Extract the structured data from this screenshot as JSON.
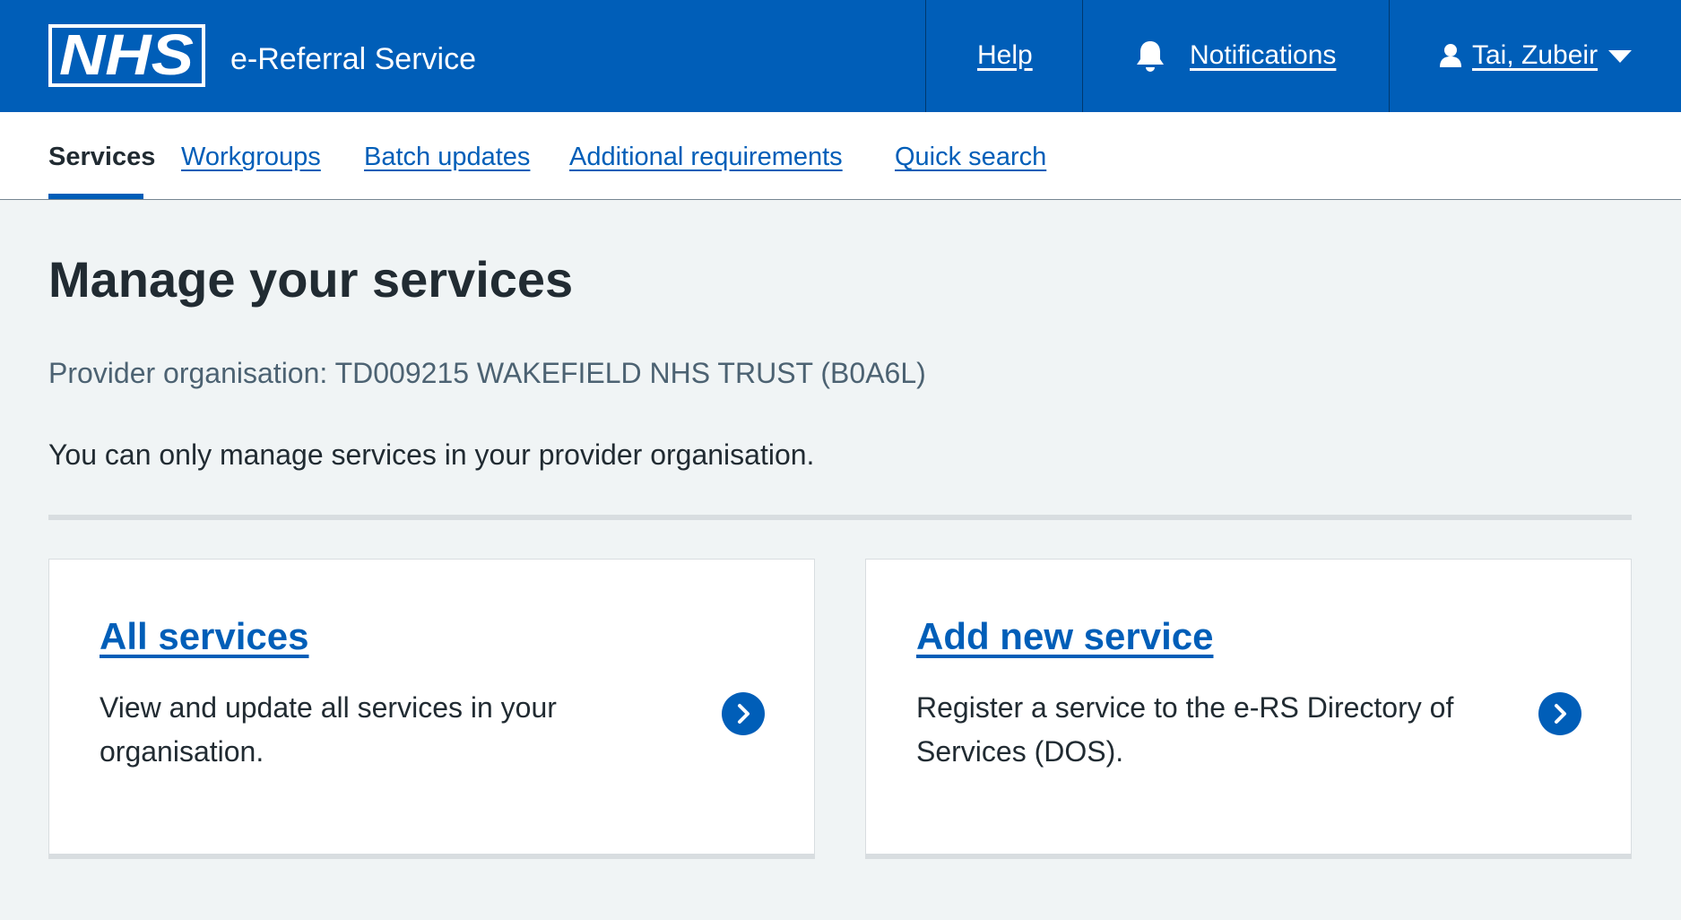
{
  "header": {
    "logo_text": "NHS",
    "service_name": "e-Referral Service",
    "help_label": "Help",
    "notifications_label": "Notifications",
    "user_label": "Tai, Zubeir"
  },
  "nav": {
    "items": [
      {
        "label": "Services",
        "active": true
      },
      {
        "label": "Workgroups"
      },
      {
        "label": "Batch updates"
      },
      {
        "label": "Additional requirements"
      },
      {
        "label": "Quick search"
      }
    ]
  },
  "main": {
    "title": "Manage your services",
    "provider": "Provider organisation: TD009215 WAKEFIELD NHS TRUST (B0A6L)",
    "lead": "You can only manage services in your provider organisation.",
    "cards": [
      {
        "title": "All services",
        "description": "View and update all services in your organisation."
      },
      {
        "title": "Add new service",
        "description": "Register a service to the e-RS Directory of Services (DOS)."
      }
    ]
  },
  "colors": {
    "nhs_blue": "#005eb8",
    "page_background": "#f0f4f5",
    "text": "#212b32",
    "secondary_text": "#4c6272",
    "border": "#d8dde0"
  },
  "icons": {
    "bell": "bell-icon",
    "user": "user-icon",
    "dropdown": "caret-down-icon",
    "arrow": "chevron-right-circle-icon"
  }
}
